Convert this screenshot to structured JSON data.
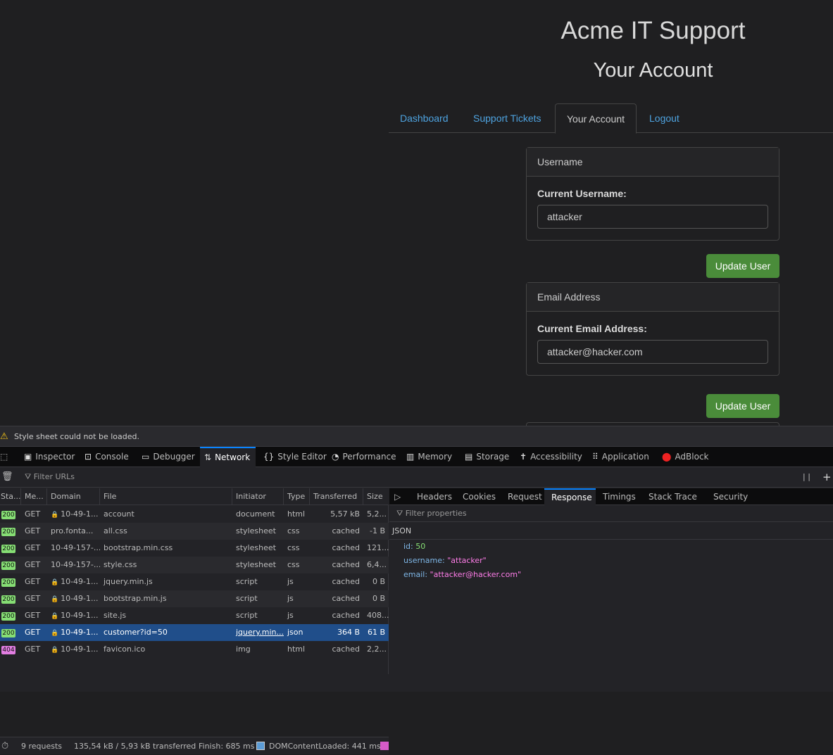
{
  "page": {
    "site_title": "Acme IT Support",
    "page_title": "Your Account",
    "tabs": [
      {
        "label": "Dashboard"
      },
      {
        "label": "Support Tickets"
      },
      {
        "label": "Your Account",
        "active": true
      },
      {
        "label": "Logout"
      }
    ],
    "username_card": {
      "header": "Username",
      "label": "Current Username:",
      "value": "attacker",
      "button": "Update User"
    },
    "email_card": {
      "header": "Email Address",
      "label": "Current Email Address:",
      "value": "attacker@hacker.com",
      "button": "Update User"
    }
  },
  "devtools": {
    "warning": "Style sheet could not be loaded.",
    "tools": [
      "Inspector",
      "Console",
      "Debugger",
      "Network",
      "Style Editor",
      "Performance",
      "Memory",
      "Storage",
      "Accessibility",
      "Application",
      "AdBlock"
    ],
    "active_tool": "Network",
    "filter_placeholder": "Filter URLs",
    "columns": [
      "Sta...",
      "Me...",
      "Domain",
      "File",
      "Initiator",
      "Type",
      "Transferred",
      "Size"
    ],
    "requests": [
      {
        "status": "200",
        "method": "GET",
        "secure": true,
        "domain": "10-49-1...",
        "file": "account",
        "initiator": "document",
        "type": "html",
        "transferred": "5,57 kB",
        "size": "5,2..."
      },
      {
        "status": "200",
        "method": "GET",
        "secure": false,
        "domain": "pro.fonta...",
        "file": "all.css",
        "initiator": "stylesheet",
        "type": "css",
        "transferred": "cached",
        "size": "-1 B"
      },
      {
        "status": "200",
        "method": "GET",
        "secure": false,
        "domain": "10-49-157-...",
        "file": "bootstrap.min.css",
        "initiator": "stylesheet",
        "type": "css",
        "transferred": "cached",
        "size": "121..."
      },
      {
        "status": "200",
        "method": "GET",
        "secure": false,
        "domain": "10-49-157-...",
        "file": "style.css",
        "initiator": "stylesheet",
        "type": "css",
        "transferred": "cached",
        "size": "6,4..."
      },
      {
        "status": "200",
        "method": "GET",
        "secure": true,
        "domain": "10-49-1...",
        "file": "jquery.min.js",
        "initiator": "script",
        "type": "js",
        "transferred": "cached",
        "size": "0 B"
      },
      {
        "status": "200",
        "method": "GET",
        "secure": true,
        "domain": "10-49-1...",
        "file": "bootstrap.min.js",
        "initiator": "script",
        "type": "js",
        "transferred": "cached",
        "size": "0 B"
      },
      {
        "status": "200",
        "method": "GET",
        "secure": true,
        "domain": "10-49-1...",
        "file": "site.js",
        "initiator": "script",
        "type": "js",
        "transferred": "cached",
        "size": "408..."
      },
      {
        "status": "200",
        "method": "GET",
        "secure": true,
        "domain": "10-49-1...",
        "file": "customer?id=50",
        "initiator": "jquery.min...",
        "type": "json",
        "transferred": "364 B",
        "size": "61 B",
        "selected": true
      },
      {
        "status": "404",
        "method": "GET",
        "secure": true,
        "domain": "10-49-1...",
        "file": "favicon.ico",
        "initiator": "img",
        "type": "html",
        "transferred": "cached",
        "size": "2,2..."
      }
    ],
    "detail_tabs": [
      "Headers",
      "Cookies",
      "Request",
      "Response",
      "Timings",
      "Stack Trace",
      "Security"
    ],
    "active_detail_tab": "Response",
    "filter_properties_placeholder": "Filter properties",
    "json_label": "JSON",
    "response": [
      {
        "key": "id",
        "value": "50",
        "kind": "num"
      },
      {
        "key": "username",
        "value": "\"attacker\"",
        "kind": "str"
      },
      {
        "key": "email",
        "value": "\"attacker@hacker.com\"",
        "kind": "str"
      }
    ],
    "summary": {
      "requests": "9 requests",
      "transferred": "135,54 kB / 5,93 kB transferred",
      "finish": "Finish: 685 ms",
      "dcl": "DOMContentLoaded: 441 ms"
    },
    "colors": {
      "status_ok": "#86de74",
      "status_404": "#e27ee2",
      "selected_row": "#204e8a",
      "accent": "#0a84ff"
    }
  }
}
